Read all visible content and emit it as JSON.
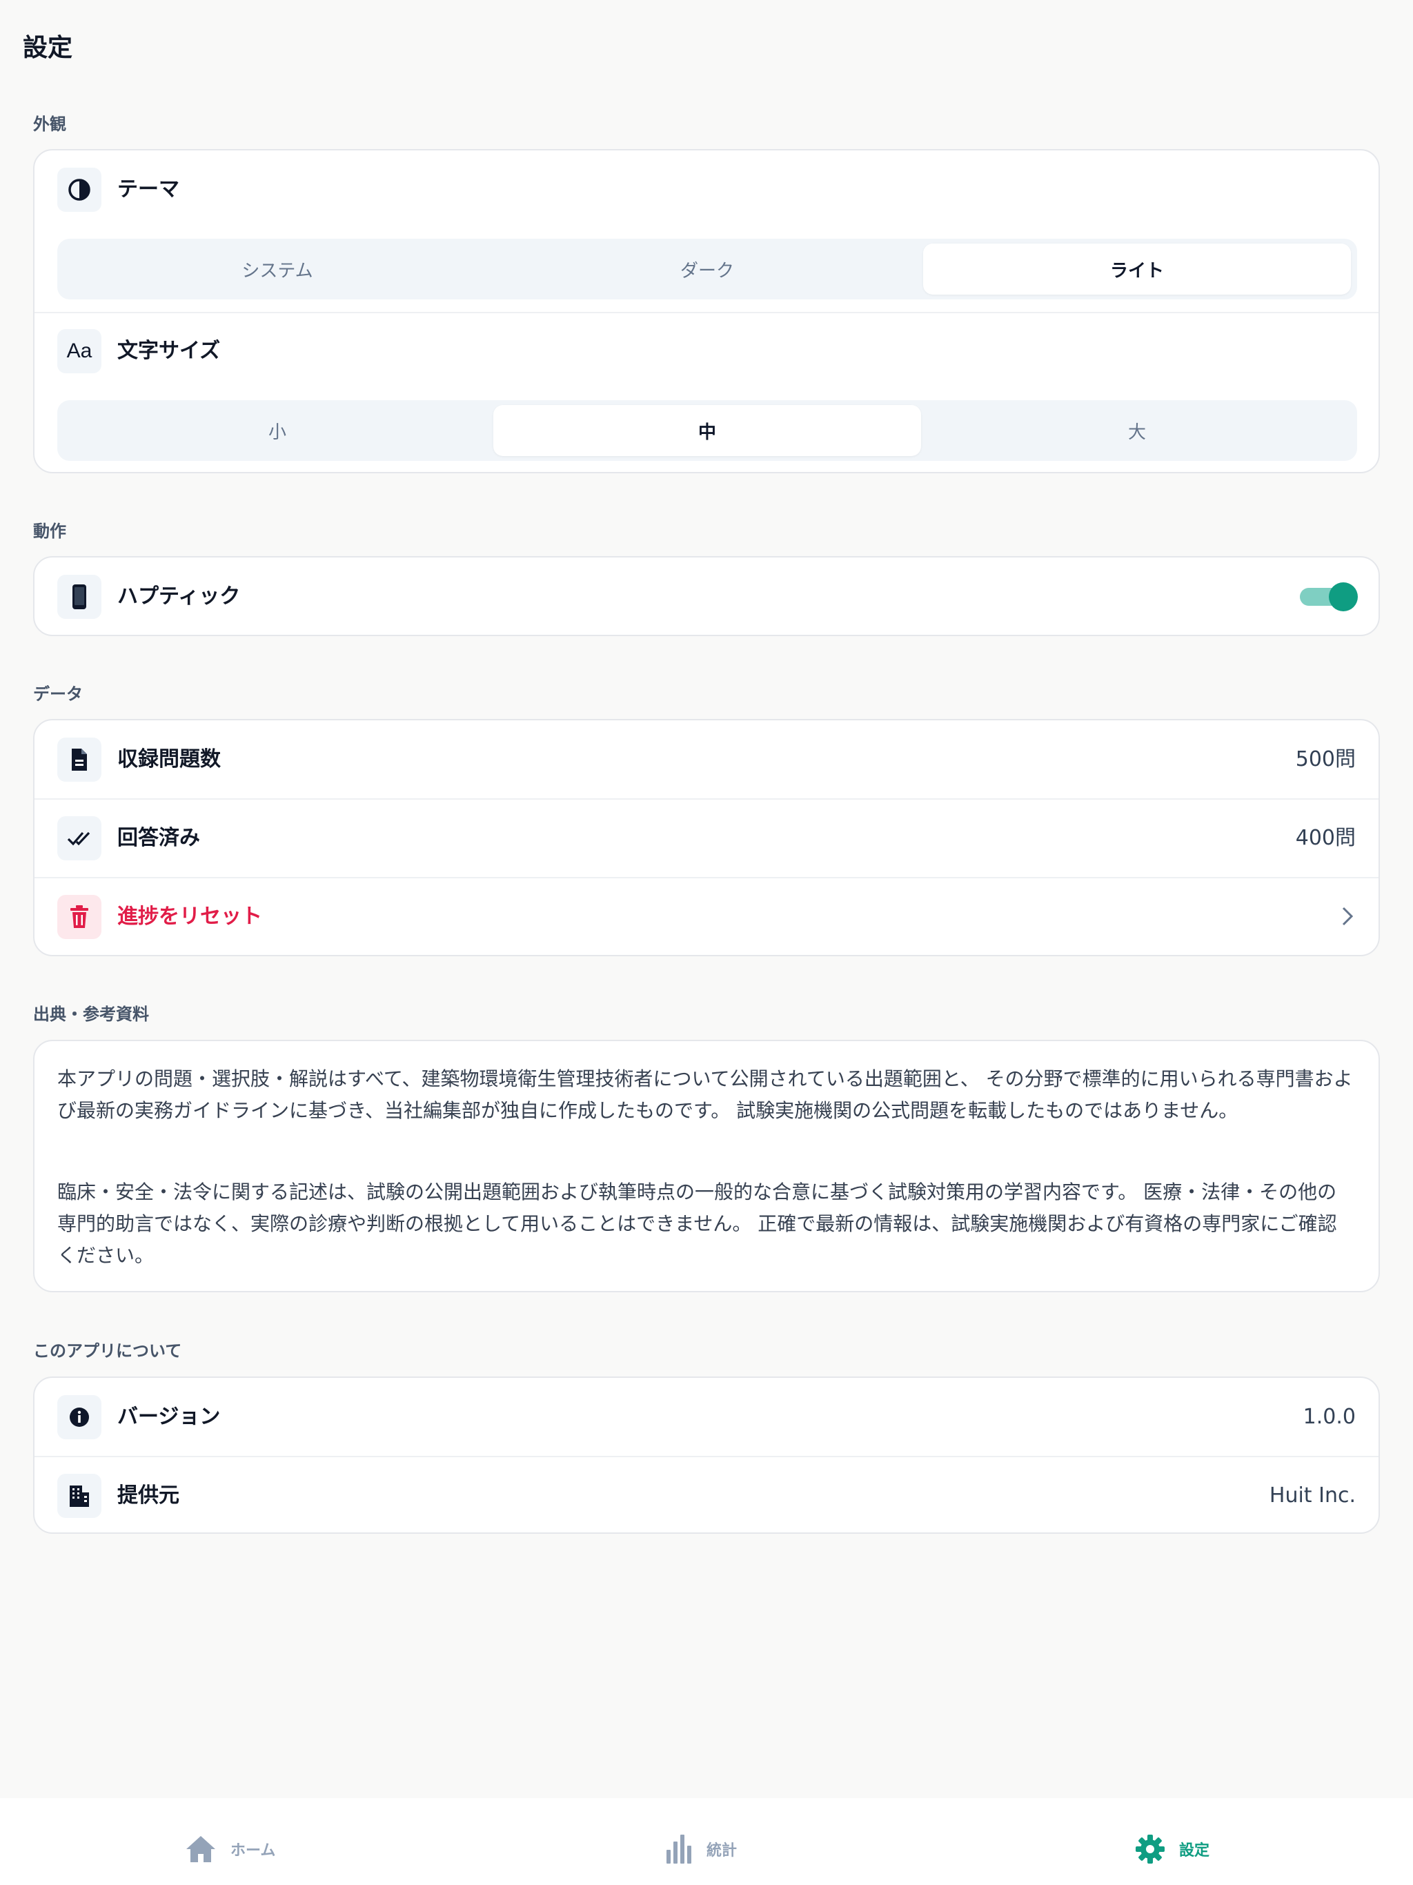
{
  "header": {
    "title": "設定"
  },
  "appearance": {
    "label": "外観",
    "theme": {
      "title": "テーマ",
      "icon": "contrast-icon",
      "options": [
        "システム",
        "ダーク",
        "ライト"
      ],
      "selected": "ライト"
    },
    "font_size": {
      "title": "文字サイズ",
      "icon": "text-size-icon",
      "icon_text": "Aa",
      "options": [
        "小",
        "中",
        "大"
      ],
      "selected": "中"
    }
  },
  "behavior": {
    "label": "動作",
    "haptic": {
      "title": "ハプティック",
      "icon": "phone-icon",
      "enabled": true
    }
  },
  "data": {
    "label": "データ",
    "rows": [
      {
        "title": "収録問題数",
        "value": "500問",
        "icon": "document-icon"
      },
      {
        "title": "回答済み",
        "value": "400問",
        "icon": "double-check-icon"
      }
    ],
    "reset": {
      "title": "進捗をリセット",
      "icon": "trash-icon",
      "color": "#e11d48"
    }
  },
  "sources": {
    "label": "出典・参考資料",
    "paragraphs": [
      "本アプリの問題・選択肢・解説はすべて、建築物環境衛生管理技術者について公開されている出題範囲と、 その分野で標準的に用いられる専門書および最新の実務ガイドラインに基づき、当社編集部が独自に作成したものです。 試験実施機関の公式問題を転載したものではありません。",
      "臨床・安全・法令に関する記述は、試験の公開出題範囲および執筆時点の一般的な合意に基づく試験対策用の学習内容です。 医療・法律・その他の専門的助言ではなく、実際の診療や判断の根拠として用いることはできません。 正確で最新の情報は、試験実施機関および有資格の専門家にご確認ください。"
    ]
  },
  "about": {
    "label": "このアプリについて",
    "rows": [
      {
        "title": "バージョン",
        "value": "1.0.0",
        "icon": "info-icon"
      },
      {
        "title": "提供元",
        "value": "Huit Inc.",
        "icon": "building-icon"
      }
    ]
  },
  "tabbar": {
    "tabs": [
      {
        "label": "ホーム",
        "icon": "home-icon"
      },
      {
        "label": "統計",
        "icon": "bar-chart-icon"
      },
      {
        "label": "設定",
        "icon": "gear-icon"
      }
    ],
    "active": "設定",
    "active_color": "#0f9d82",
    "inactive_color": "#94a3b8"
  }
}
